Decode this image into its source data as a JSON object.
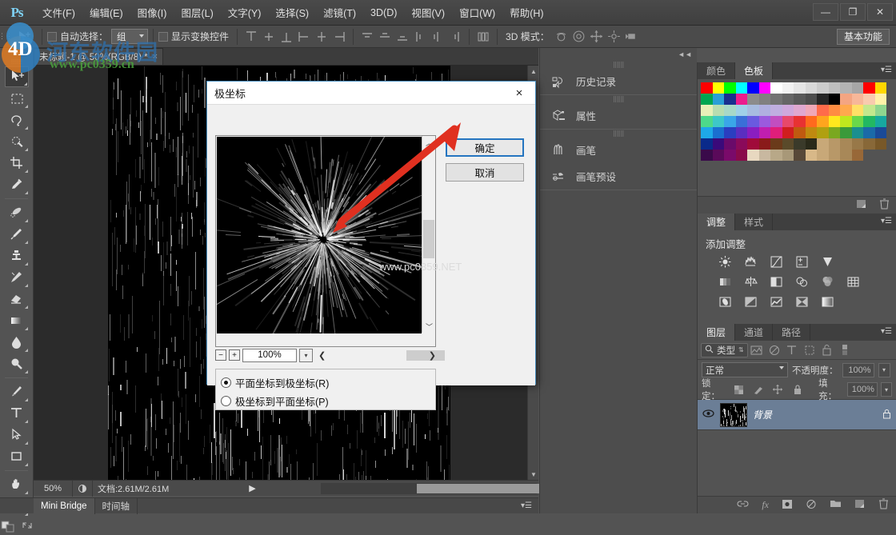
{
  "app": {
    "logo": "Ps",
    "window_controls": [
      "minimize",
      "maximize",
      "close"
    ]
  },
  "menubar": {
    "items": [
      {
        "label": "文件(F)",
        "name": "menu-file"
      },
      {
        "label": "编辑(E)",
        "name": "menu-edit"
      },
      {
        "label": "图像(I)",
        "name": "menu-image"
      },
      {
        "label": "图层(L)",
        "name": "menu-layer"
      },
      {
        "label": "文字(Y)",
        "name": "menu-type"
      },
      {
        "label": "选择(S)",
        "name": "menu-select"
      },
      {
        "label": "滤镜(T)",
        "name": "menu-filter"
      },
      {
        "label": "3D(D)",
        "name": "menu-3d"
      },
      {
        "label": "视图(V)",
        "name": "menu-view"
      },
      {
        "label": "窗口(W)",
        "name": "menu-window"
      },
      {
        "label": "帮助(H)",
        "name": "menu-help"
      }
    ]
  },
  "options_bar": {
    "auto_select_label": "自动选择：",
    "auto_select_value": "组",
    "show_transform_label": "显示变换控件",
    "mode_3d_label": "3D 模式：",
    "workspace": "基本功能"
  },
  "document_tab": {
    "title": "未标题-1 @ 50%(RGB/8) *",
    "close": "×"
  },
  "status_bar": {
    "zoom": "50%",
    "doc_info": "文档:2.61M/2.61M"
  },
  "bottom_tabs": {
    "mini_bridge": "Mini Bridge",
    "timeline": "时间轴"
  },
  "icon_dock": {
    "items": [
      {
        "label": "历史记录",
        "icon": "history-icon"
      },
      {
        "label": "属性",
        "icon": "properties-icon"
      },
      {
        "label": "画笔",
        "icon": "brush-icon"
      },
      {
        "label": "画笔预设",
        "icon": "brush-preset-icon"
      }
    ]
  },
  "color_panel": {
    "tab_color": "颜色",
    "tab_swatches": "色板",
    "active_tab": "色板",
    "swatches": [
      "#ff0000",
      "#ffff00",
      "#00ff00",
      "#00ffff",
      "#0000ff",
      "#ff00ff",
      "#ffffff",
      "#f2f2f2",
      "#e6e6e6",
      "#d9d9d9",
      "#cccccc",
      "#bfbfbf",
      "#b3b3b3",
      "#a6a6a6",
      "#ff0000",
      "#ffd700",
      "#00a651",
      "#2a9fd6",
      "#1a2f8f",
      "#ec1c8e",
      "#8c8c8c",
      "#808080",
      "#737373",
      "#666666",
      "#595959",
      "#4d4d4d",
      "#262626",
      "#000000",
      "#f4a582",
      "#f7b799",
      "#f9cbae",
      "#fff2a8",
      "#e8f0b8",
      "#b8ddb0",
      "#a8d8c8",
      "#a0d0e8",
      "#a8bce0",
      "#b0b0e0",
      "#c0aee0",
      "#cfa8dc",
      "#e0a8d0",
      "#f0a8b8",
      "#ff6b4a",
      "#ff8c42",
      "#ffa94d",
      "#ffe066",
      "#c3e88d",
      "#8fd68f",
      "#4dd98a",
      "#3ec8c8",
      "#3aa6e8",
      "#3a6fd8",
      "#6a5ae0",
      "#9b5ade",
      "#c24ec0",
      "#e8486a",
      "#e83232",
      "#ff6a1e",
      "#ffa51e",
      "#ffe81e",
      "#bfe81e",
      "#6ad84a",
      "#22b862",
      "#17a8a0",
      "#1ea8e8",
      "#1a6fd0",
      "#2a3ec0",
      "#5a2ec0",
      "#8a1ec0",
      "#c01eb0",
      "#e01e7a",
      "#d01e1e",
      "#c05a10",
      "#c08a10",
      "#b0a010",
      "#7aa820",
      "#3a9a3a",
      "#1a8f8f",
      "#1a6aa8",
      "#1a4a98",
      "#0a2a8a",
      "#3a0a7a",
      "#6a0a6a",
      "#8a0a5a",
      "#a00a3a",
      "#8a1a1a",
      "#6a3a1a",
      "#5a4a2a",
      "#3a3a2a",
      "#2a2a1a",
      "#c8a878",
      "#b89868",
      "#a88858",
      "#987848",
      "#886838",
      "#785828",
      "#3a0a4a",
      "#5a0a5a",
      "#7a0a6a",
      "#8a0a4a",
      "#e8d8c0",
      "#c8b8a0",
      "#b8a888",
      "#a89878",
      "#584838",
      "#d8b888",
      "#c8a878",
      "#b89868",
      "#a88858",
      "#986838",
      "",
      ""
    ]
  },
  "adjustments_panel": {
    "tab_adjustments": "调整",
    "tab_styles": "样式",
    "active_tab": "调整",
    "title": "添加调整",
    "icons": [
      [
        "brightness-icon",
        "levels-icon",
        "curves-icon",
        "exposure-icon",
        "vibrance-icon"
      ],
      [
        "hue-saturation-icon",
        "color-balance-icon",
        "black-white-icon",
        "photo-filter-icon",
        "channel-mixer-icon",
        "color-lookup-icon"
      ],
      [
        "invert-icon",
        "posterize-icon",
        "threshold-icon",
        "selective-color-icon",
        "gradient-map-icon"
      ]
    ]
  },
  "layers_panel": {
    "tab_layers": "图层",
    "tab_channels": "通道",
    "tab_paths": "路径",
    "active_tab": "图层",
    "filter_label": "类型",
    "blend_mode": "正常",
    "opacity_label": "不透明度：",
    "opacity_value": "100%",
    "lock_label": "锁定：",
    "fill_label": "填充：",
    "fill_value": "100%",
    "rows": [
      {
        "name": "背景",
        "locked": true,
        "visible": true
      }
    ],
    "footer_icons": [
      "link-icon",
      "fx-icon",
      "mask-icon",
      "adjustment-icon",
      "group-icon",
      "new-layer-icon",
      "delete-icon"
    ]
  },
  "dialog": {
    "title": "极坐标",
    "close": "×",
    "ok_button": "确定",
    "cancel_button": "取消",
    "zoom_value": "100%",
    "zoom_out": "−",
    "zoom_in": "+",
    "options": [
      {
        "label": "平面坐标到极坐标(R)",
        "selected": true
      },
      {
        "label": "极坐标到平面坐标(P)",
        "selected": false
      }
    ],
    "watermark": "www.pc0359.NET"
  },
  "watermarks": {
    "site_cn": "河东软件园",
    "site_url": "www.pc0359.cn",
    "canvas_text": "www.pc0359.NET",
    "logo_text": "4D"
  },
  "toolbar": {
    "tools": [
      {
        "name": "move-tool",
        "active": true
      },
      {
        "name": "marquee-tool",
        "active": false
      },
      {
        "name": "lasso-tool",
        "active": false
      },
      {
        "name": "quick-select-tool",
        "active": false
      },
      {
        "name": "crop-tool",
        "active": false
      },
      {
        "name": "eyedropper-tool",
        "active": false
      },
      {
        "name": "healing-brush-tool",
        "active": false
      },
      {
        "name": "brush-tool",
        "active": false
      },
      {
        "name": "clone-stamp-tool",
        "active": false
      },
      {
        "name": "history-brush-tool",
        "active": false
      },
      {
        "name": "eraser-tool",
        "active": false
      },
      {
        "name": "gradient-tool",
        "active": false
      },
      {
        "name": "blur-tool",
        "active": false
      },
      {
        "name": "dodge-tool",
        "active": false
      },
      {
        "name": "pen-tool",
        "active": false
      },
      {
        "name": "type-tool",
        "active": false
      },
      {
        "name": "path-selection-tool",
        "active": false
      },
      {
        "name": "shape-tool",
        "active": false
      },
      {
        "name": "hand-tool",
        "active": false
      },
      {
        "name": "zoom-tool",
        "active": false
      }
    ]
  },
  "colors": {
    "chrome": "#535353",
    "panel": "#4d4d4d",
    "accent_blue": "#2575c0",
    "layer_selected": "#6b7e96",
    "annotation_red": "#e03020"
  }
}
